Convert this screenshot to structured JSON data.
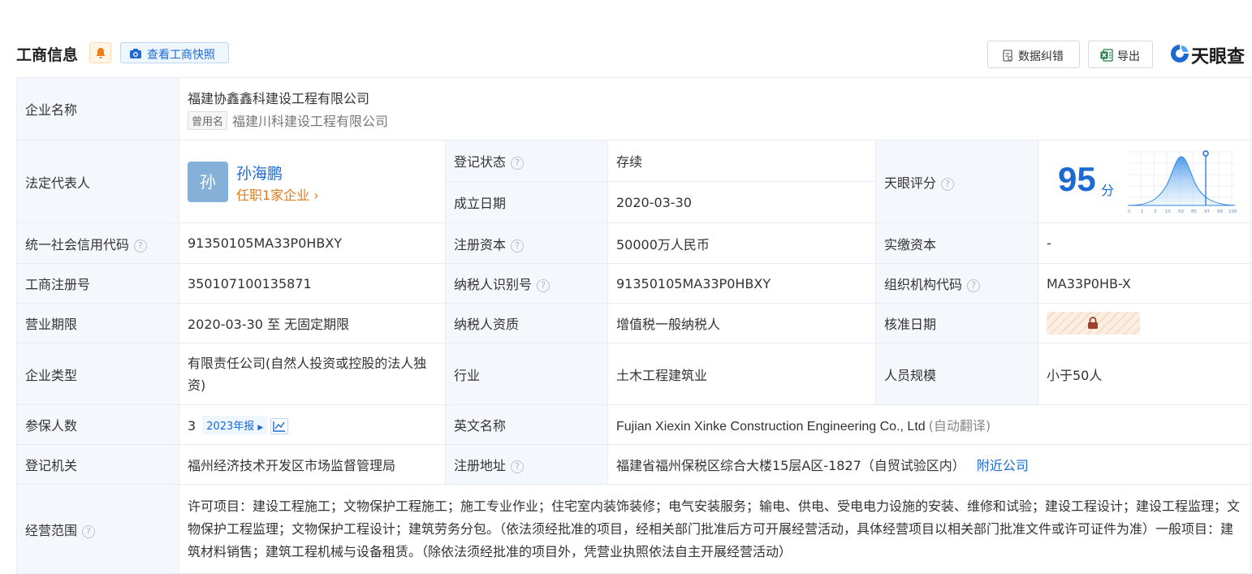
{
  "header": {
    "title": "工商信息",
    "snapshot_label": "查看工商快照",
    "correct_label": "数据纠错",
    "export_label": "导出",
    "logo_text": "天眼查"
  },
  "company": {
    "label": "企业名称",
    "name": "福建协鑫鑫科建设工程有限公司",
    "former_tag": "曾用名",
    "former_name": "福建川科建设工程有限公司"
  },
  "legal_rep": {
    "label": "法定代表人",
    "avatar_char": "孙",
    "name": "孙海鹏",
    "positions": "任职1家企业",
    "chevron": "›"
  },
  "reg_status": {
    "label": "登记状态",
    "value": "存续"
  },
  "founded": {
    "label": "成立日期",
    "value": "2020-03-30"
  },
  "tianyan_score": {
    "label": "天眼评分",
    "score": "95",
    "unit": "分",
    "ticks": [
      "0",
      "1",
      "3",
      "15",
      "50",
      "85",
      "97",
      "99",
      "100"
    ]
  },
  "credit_code": {
    "label": "统一社会信用代码",
    "value": "91350105MA33P0HBXY"
  },
  "reg_capital": {
    "label": "注册资本",
    "value": "50000万人民币"
  },
  "paid_capital": {
    "label": "实缴资本",
    "value": "-"
  },
  "biz_reg_no": {
    "label": "工商注册号",
    "value": "350107100135871"
  },
  "taxpayer_id": {
    "label": "纳税人识别号",
    "value": "91350105MA33P0HBXY"
  },
  "org_code": {
    "label": "组织机构代码",
    "value": "MA33P0HB-X"
  },
  "biz_term": {
    "label": "营业期限",
    "value": "2020-03-30 至 无固定期限"
  },
  "taxpayer_type": {
    "label": "纳税人资质",
    "value": "增值税一般纳税人"
  },
  "approval_date": {
    "label": "核准日期"
  },
  "company_type": {
    "label": "企业类型",
    "value": "有限责任公司(自然人投资或控股的法人独资)"
  },
  "industry": {
    "label": "行业",
    "value": "土木工程建筑业"
  },
  "staff_size": {
    "label": "人员规模",
    "value": "小于50人"
  },
  "insured": {
    "label": "参保人数",
    "value": "3",
    "report_label": "2023年报"
  },
  "english_name": {
    "label": "英文名称",
    "value": "Fujian Xiexin Xinke Construction Engineering Co., Ltd",
    "note": "(自动翻译)"
  },
  "registrar": {
    "label": "登记机关",
    "value": "福州经济技术开发区市场监督管理局"
  },
  "address": {
    "label": "注册地址",
    "value": "福建省福州保税区综合大楼15层A区-1827（自贸试验区内）",
    "nearby_label": "附近公司"
  },
  "scope": {
    "label": "经营范围",
    "value": "许可项目：建设工程施工；文物保护工程施工；施工专业作业；住宅室内装饰装修；电气安装服务；输电、供电、受电电力设施的安装、维修和试验；建设工程设计；建设工程监理；文物保护工程监理；文物保护工程设计；建筑劳务分包。（依法须经批准的项目，经相关部门批准后方可开展经营活动，具体经营项目以相关部门批准文件或许可证件为准）一般项目：建筑材料销售；建筑工程机械与设备租赁。（除依法须经批准的项目外，凭营业执照依法自主开展经营活动）"
  },
  "icons": {
    "help": "?",
    "bell": "bell-icon",
    "camera": "camera-icon",
    "correct": "edit-doc-icon",
    "export": "excel-icon",
    "trend": "trend-chart-icon",
    "lock": "lock-icon",
    "logo": "tianyancha-logo"
  },
  "colors": {
    "accent": "#1c69d4",
    "green": "#2f9e44",
    "orange": "#e07b1d",
    "label_bg": "#f4f8fc"
  }
}
